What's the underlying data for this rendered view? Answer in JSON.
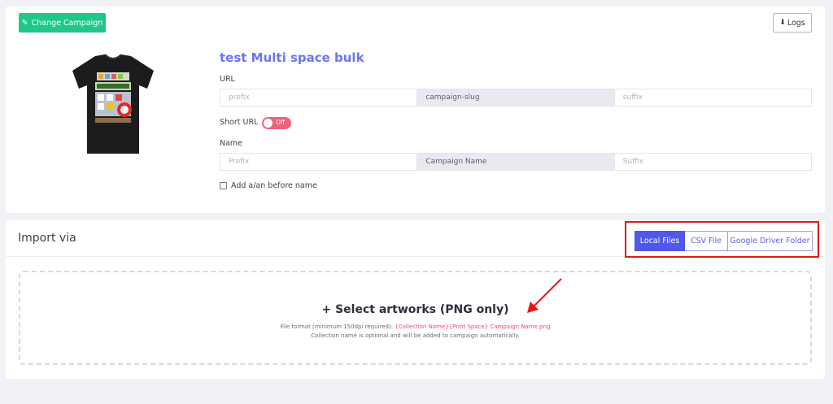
{
  "header": {
    "change_campaign_label": "Change Campaign",
    "logs_label": "Logs"
  },
  "campaign": {
    "title": "test Multi space bulk",
    "url_label": "URL",
    "url_prefix_placeholder": "prefix",
    "url_slug": "campaign-slug",
    "url_suffix_placeholder": "suffix",
    "short_url_label": "Short URL",
    "short_url_state": "Off",
    "name_label": "Name",
    "name_prefix_placeholder": "Prefix",
    "name_value": "Campaign Name",
    "name_suffix_placeholder": "Suffix",
    "article_checkbox_label": "Add a/an before name"
  },
  "import": {
    "title": "Import via",
    "tabs": [
      "Local Files",
      "CSV File",
      "Google Driver Folder"
    ],
    "active_tab": "Local Files",
    "dropzone": {
      "title": "+ Select artworks (PNG only)",
      "format_prefix": "File format (minimum 150dpi required): ",
      "format_pattern": "{Collection Name}{Print Space} Campaign Name.png",
      "note": "Collection name is optional and will be added to campaign automatically."
    }
  },
  "colors": {
    "accent": "#4f58e7",
    "success": "#1cc88a",
    "toggle_off": "#f0617a",
    "highlight": "#e0191c"
  }
}
